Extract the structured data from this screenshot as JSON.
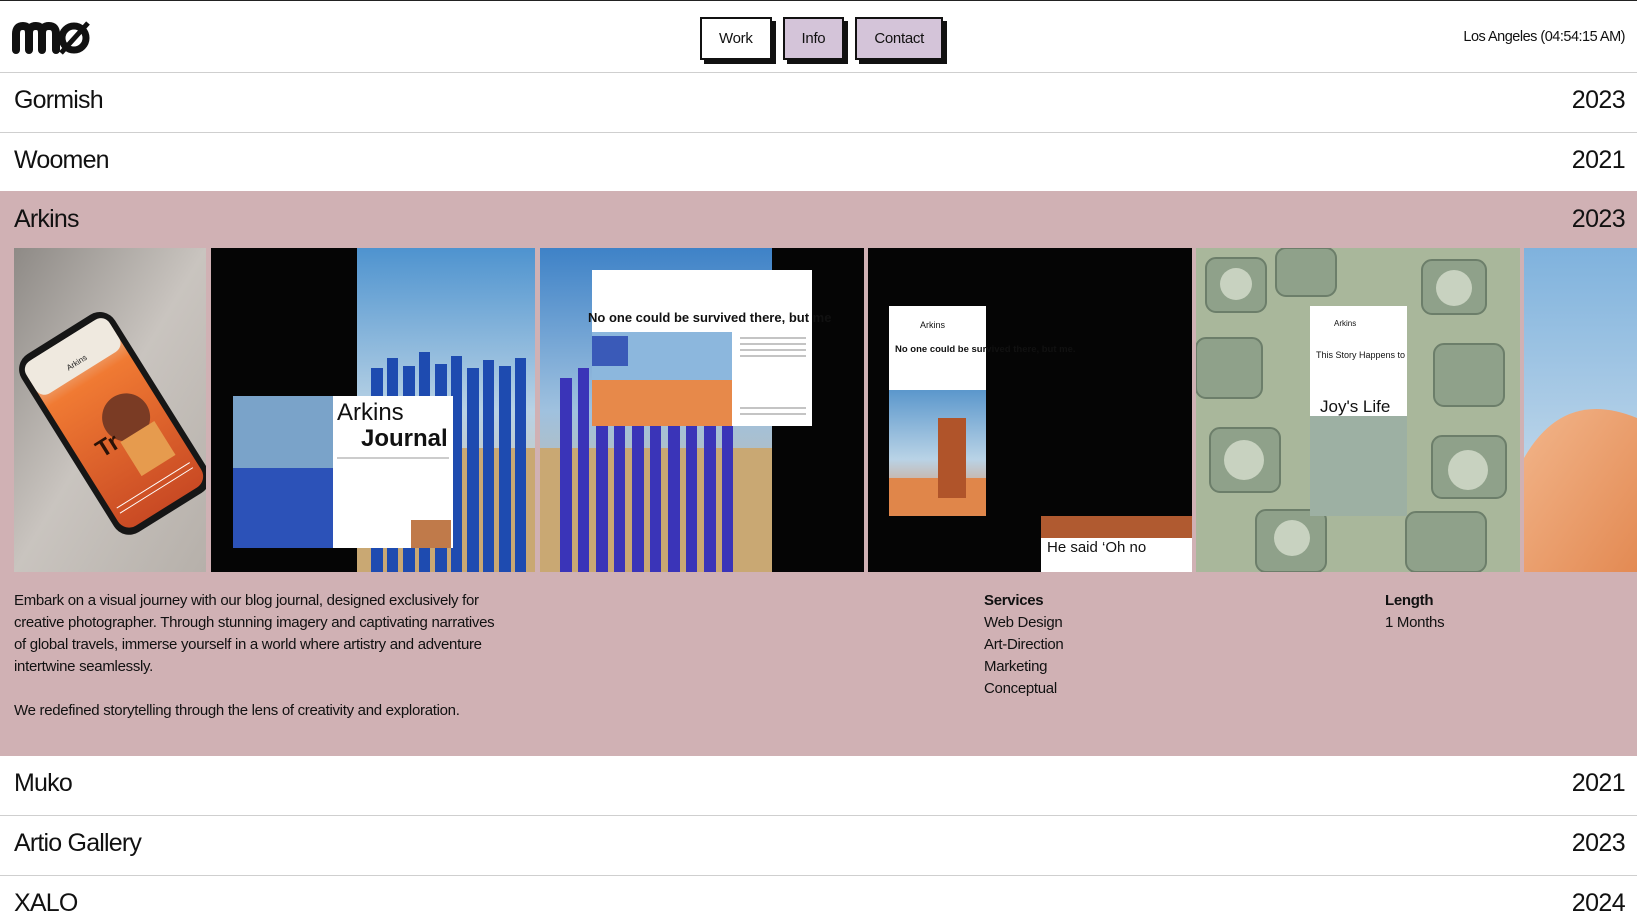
{
  "header": {
    "brand": "mø",
    "nav": [
      {
        "label": "Work"
      },
      {
        "label": "Info"
      },
      {
        "label": "Contact"
      }
    ],
    "clock": "Los Angeles (04:54:15 AM)"
  },
  "projects": [
    {
      "name": "Gormish",
      "year": "2023"
    },
    {
      "name": "Woomen",
      "year": "2021"
    },
    {
      "name": "Arkins",
      "year": "2023"
    },
    {
      "name": "Muko",
      "year": "2021"
    },
    {
      "name": "Artio Gallery",
      "year": "2023"
    },
    {
      "name": "XALO",
      "year": "2024"
    }
  ],
  "detail": {
    "description": [
      "Embark on a visual journey with our blog journal, designed exclusively for creative photographer. Through stunning imagery and captivating narratives of global travels, immerse yourself in a world where artistry and adventure intertwine seamlessly.",
      "We redefined storytelling through the lens of creativity and exploration."
    ],
    "services_label": "Services",
    "services": [
      "Web Design",
      "Art-Direction",
      "Marketing",
      "Conceptual"
    ],
    "length_label": "Length",
    "length": "1 Months"
  },
  "gallery": {
    "phone_brand": "Arkins",
    "phone_big_text": "Tr",
    "journal_title_1": "Arkins",
    "journal_title_2": "Journal",
    "desktop_headline": "No one could be survived there, but me",
    "mobile_headline": "No one could be survived there, but me.",
    "mobile_story": "He said ‘Oh no",
    "story_title": "This Story Happens to",
    "story_big": "Joy's Life"
  },
  "colors": {
    "accent_row": "#d0b1b4",
    "nav_tint": "#d4c4d9"
  }
}
